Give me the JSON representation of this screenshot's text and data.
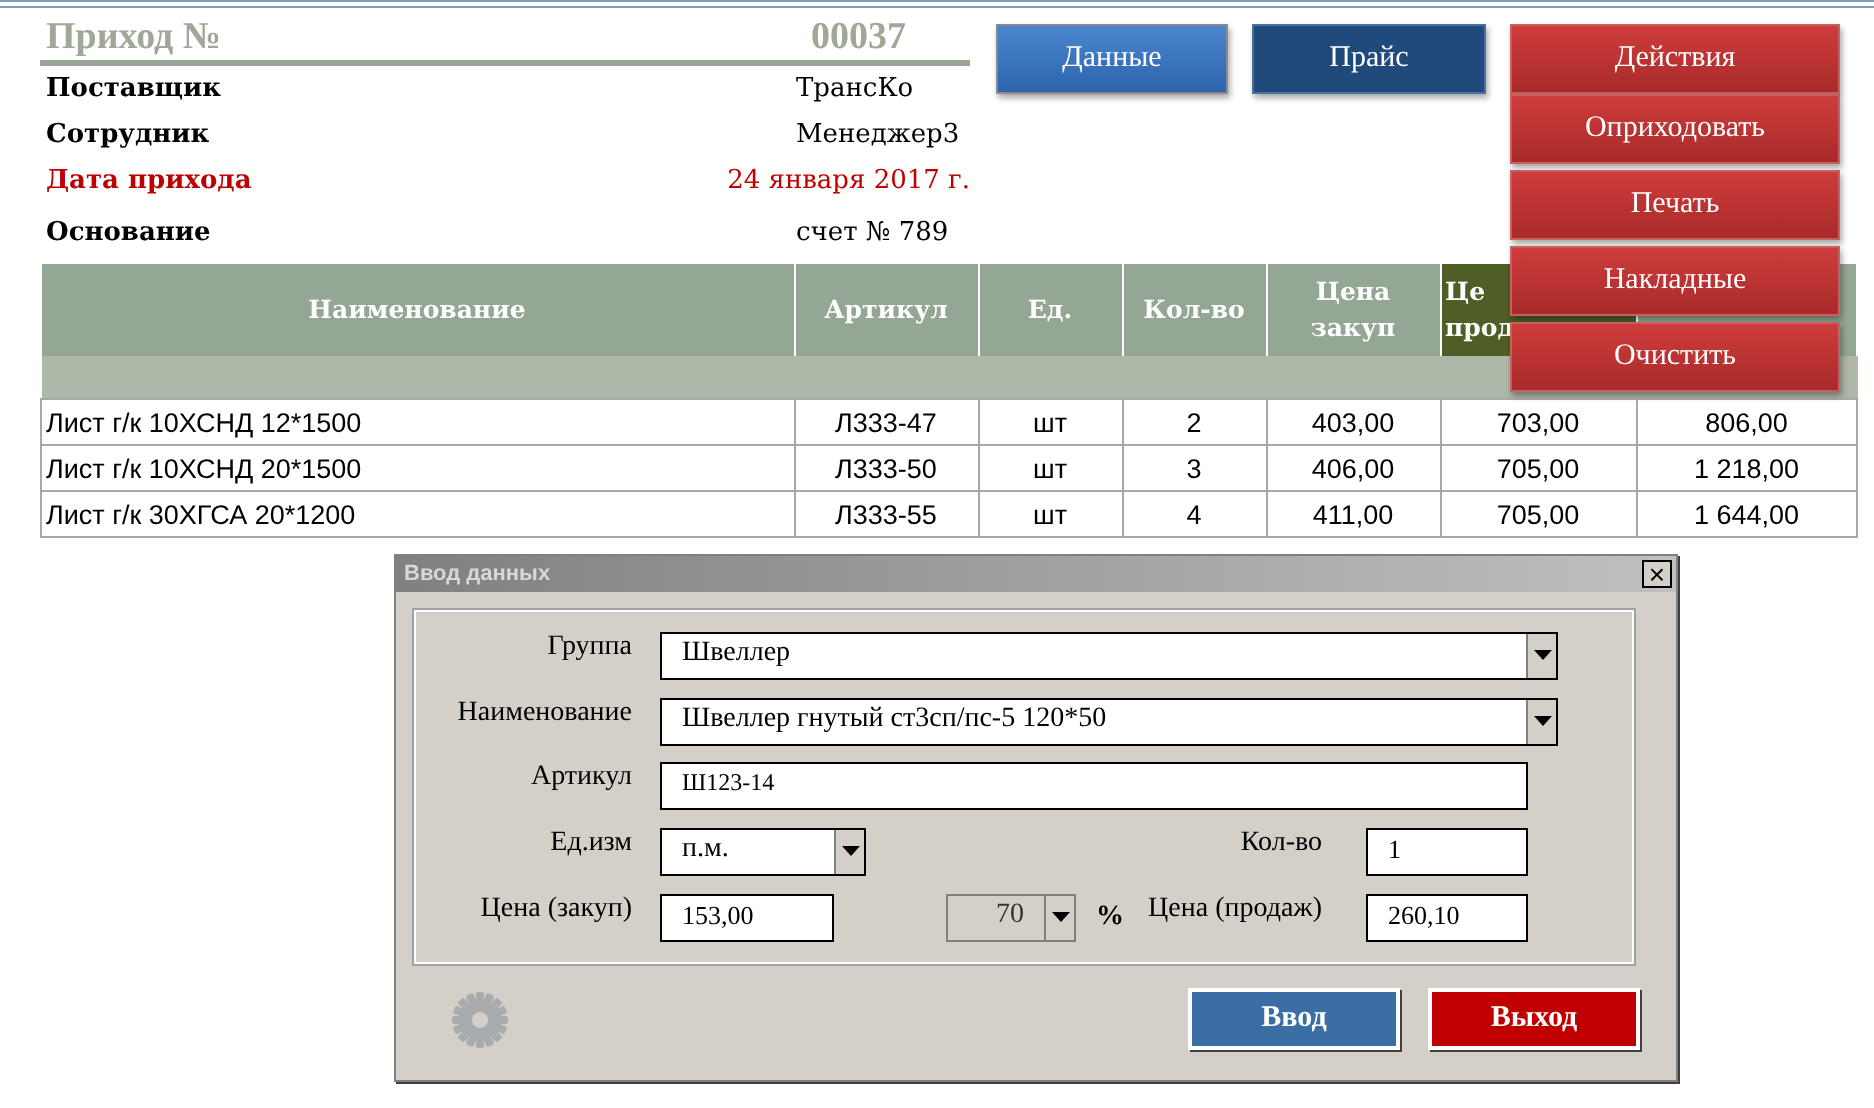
{
  "header": {
    "title": "Приход №",
    "number": "00037",
    "fields": [
      {
        "label": "Поставщик",
        "value": "ТрансКо",
        "kind": "plain"
      },
      {
        "label": "Сотрудник",
        "value": "Менеджер3",
        "kind": "plain"
      },
      {
        "label": "Дата прихода",
        "value": "24 января 2017 г.",
        "kind": "accent"
      },
      {
        "label": "Основание",
        "value": "счет № 789",
        "kind": "plain"
      }
    ]
  },
  "buttons": [
    {
      "label": "Данные",
      "kind": "light"
    },
    {
      "label": "Прайс",
      "kind": "dark"
    },
    {
      "label": "Действия",
      "kind": "danger"
    }
  ],
  "menu": {
    "items": [
      "Оприходовать",
      "Печать",
      "Накладные",
      "Очистить"
    ]
  },
  "table": {
    "columns": [
      {
        "lines": [
          "Наименование"
        ],
        "kind": "plain"
      },
      {
        "lines": [
          "Артикул"
        ],
        "kind": "plain"
      },
      {
        "lines": [
          "Ед."
        ],
        "kind": "plain"
      },
      {
        "lines": [
          "Кол-во"
        ],
        "kind": "plain"
      },
      {
        "lines": [
          "Цена",
          "закуп"
        ],
        "kind": "plain"
      },
      {
        "lines": [
          "Це",
          "прод"
        ],
        "kind": "accent"
      },
      {
        "kind": "plain"
      }
    ],
    "rows": [
      [
        "Лист г/к  10ХСНД 12*1500",
        "Л333-47",
        "шт",
        "2",
        "403,00",
        "703,00",
        "806,00"
      ],
      [
        "Лист г/к  10ХСНД 20*1500",
        "Л333-50",
        "шт",
        "3",
        "406,00",
        "705,00",
        "1 218,00"
      ],
      [
        "Лист г/к  30ХГСА 20*1200",
        "Л333-55",
        "шт",
        "4",
        "411,00",
        "705,00",
        "1 644,00"
      ]
    ]
  },
  "dialog": {
    "title": "Ввод данных",
    "close": "×",
    "rows": [
      [
        {
          "label": "Группа",
          "value": "Швеллер",
          "kind": "combo",
          "disabled": false
        }
      ],
      [
        {
          "label": "Наименование",
          "value": "Швеллер гнутый  ст3сп/пс-5 120*50",
          "kind": "combo",
          "disabled": false
        }
      ],
      [
        {
          "label": "Артикул",
          "value": "Ш123-14",
          "kind": "text"
        }
      ],
      [
        {
          "label": "Ед.изм",
          "value": "п.м.",
          "kind": "combo",
          "disabled": false
        },
        "",
        {
          "label": "Кол-во",
          "value": "1",
          "kind": "text"
        }
      ],
      [
        {
          "label": "Цена (закуп)",
          "value": "153,00",
          "kind": "text"
        },
        {
          "value": "70",
          "unit": "%",
          "kind": "percent",
          "disabled": true
        },
        {
          "label": "Цена (продаж)",
          "value": "260,10",
          "kind": "text"
        }
      ]
    ],
    "buttons": [
      {
        "label": "Ввод",
        "kind": "primary"
      },
      {
        "label": "Выход",
        "kind": "danger"
      }
    ]
  }
}
